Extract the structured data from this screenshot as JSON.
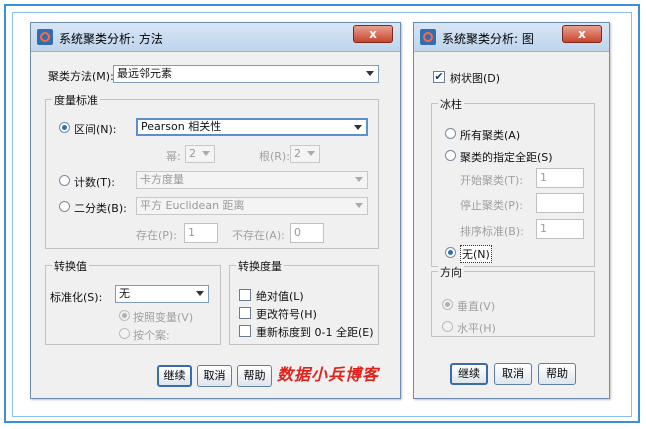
{
  "method_dialog": {
    "title": "系统聚类分析: 方法",
    "close_label": "x",
    "cluster_method_label": "聚类方法(M):",
    "cluster_method_value": "最远邻元素",
    "measure_group": "度量标准",
    "interval_label": "区间(N):",
    "interval_value": "Pearson 相关性",
    "power_label": "幂:",
    "power_value": "2",
    "root_label": "根(R):",
    "root_value": "2",
    "count_label": "计数(T):",
    "count_value": "卡方度量",
    "binary_label": "二分类(B):",
    "binary_value": "平方 Euclidean 距离",
    "present_label": "存在(P):",
    "present_value": "1",
    "absent_label": "不存在(A):",
    "absent_value": "0",
    "transform_values_group": "转换值",
    "standardize_label": "标准化(S):",
    "standardize_value": "无",
    "by_variable_label": "按照变量(V)",
    "by_case_label": "按个案:",
    "transform_measures_group": "转换度量",
    "absolute_label": "绝对值(L)",
    "change_sign_label": "更改符号(H)",
    "rescale_label": "重新标度到 0-1 全距(E)",
    "continue_label": "继续",
    "cancel_label": "取消",
    "help_label": "帮助"
  },
  "plot_dialog": {
    "title": "系统聚类分析: 图",
    "close_label": "x",
    "dendrogram_label": "树状图(D)",
    "dendrogram_checked": true,
    "icicle_group": "冰柱",
    "all_clusters_label": "所有聚类(A)",
    "range_label": "聚类的指定全距(S)",
    "start_label": "开始聚类(T):",
    "start_value": "1",
    "stop_label": "停止聚类(P):",
    "stop_value": "",
    "by_label": "排序标准(B):",
    "by_value": "1",
    "none_label": "无(N)",
    "orientation_group": "方向",
    "vertical_label": "垂直(V)",
    "horizontal_label": "水平(H)",
    "continue_label": "继续",
    "cancel_label": "取消",
    "help_label": "帮助"
  },
  "watermark": "数据小兵博客",
  "colors": {
    "frame": "#3b8fd6",
    "watermark": "#e0221b",
    "close": "#c8452f"
  }
}
